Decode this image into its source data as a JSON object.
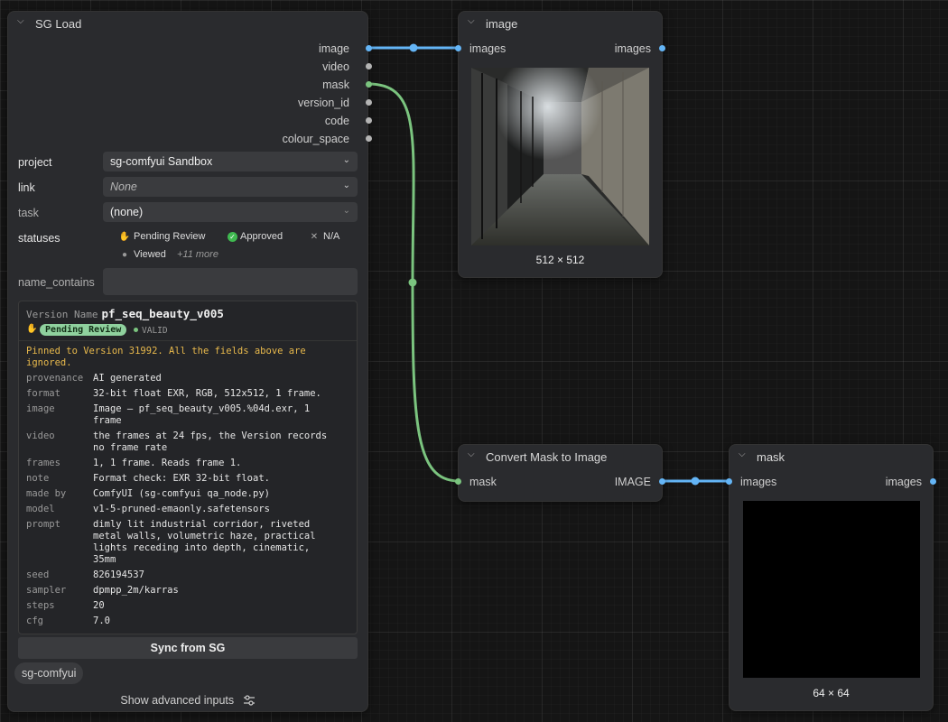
{
  "sg_load": {
    "title": "SG Load",
    "outputs": [
      "image",
      "video",
      "mask",
      "version_id",
      "code",
      "colour_space"
    ],
    "project_label": "project",
    "project_value": "sg-comfyui Sandbox",
    "link_label": "link",
    "link_value": "None",
    "task_label": "task",
    "task_value": "(none)",
    "statuses_label": "statuses",
    "statuses": [
      {
        "icon": "hand-icon",
        "label": "Pending Review"
      },
      {
        "icon": "check-icon",
        "label": "Approved"
      },
      {
        "icon": "cross-icon",
        "label": "N/A"
      },
      {
        "icon": "dot-icon",
        "label": "Viewed"
      }
    ],
    "statuses_more": "+11 more",
    "name_contains_label": "name_contains",
    "name_contains_value": "",
    "info": {
      "version_name_label": "Version Name",
      "version_name": "pf_seq_beauty_v005",
      "status_badge": "Pending Review",
      "valid_label": "VALID",
      "warning": "Pinned to Version 31992. All the fields above are ignored.",
      "fields": [
        {
          "key": "provenance",
          "value": "AI generated"
        },
        {
          "key": "format",
          "value": "32-bit float EXR, RGB, 512x512, 1 frame."
        },
        {
          "key": "image",
          "value": "Image — pf_seq_beauty_v005.%04d.exr, 1 frame"
        },
        {
          "key": "video",
          "value": "the frames at 24 fps, the Version records no frame rate"
        },
        {
          "key": "frames",
          "value": "1, 1 frame. Reads frame 1."
        },
        {
          "key": "note",
          "value": "Format check: EXR 32-bit float."
        },
        {
          "key": "made by",
          "value": "ComfyUI (sg-comfyui qa_node.py)"
        },
        {
          "key": "model",
          "value": "v1-5-pruned-emaonly.safetensors"
        },
        {
          "key": "prompt",
          "value": "dimly lit industrial corridor, riveted metal walls, volumetric haze, practical lights receding into depth, cinematic, 35mm"
        },
        {
          "key": "seed",
          "value": "826194537"
        },
        {
          "key": "sampler",
          "value": "dpmpp_2m/karras"
        },
        {
          "key": "steps",
          "value": "20"
        },
        {
          "key": "cfg",
          "value": "7.0"
        }
      ]
    },
    "sync_button": "Sync from SG",
    "tag_chip": "sg-comfyui",
    "advanced_label": "Show advanced inputs"
  },
  "image_node": {
    "title": "image",
    "input": "images",
    "output": "images",
    "dims": "512 × 512"
  },
  "convert_node": {
    "title": "Convert Mask to Image",
    "input": "mask",
    "output": "IMAGE"
  },
  "mask_node": {
    "title": "mask",
    "input": "images",
    "output": "images",
    "dims": "64 × 64"
  },
  "colors": {
    "image_link": "#64b5f6",
    "mask_link": "#7bc47f",
    "warning": "#e8b94c",
    "badge": "#8fd19e"
  }
}
